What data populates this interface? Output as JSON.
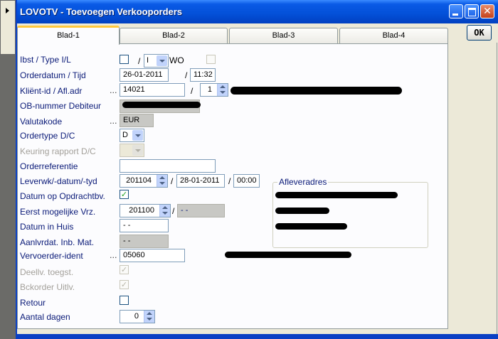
{
  "window": {
    "title": "LOVOTV - Toevoegen Verkooporders"
  },
  "tabs": [
    {
      "label": "Blad-1",
      "active": true
    },
    {
      "label": "Blad-2",
      "active": false
    },
    {
      "label": "Blad-3",
      "active": false
    },
    {
      "label": "Blad-4",
      "active": false
    }
  ],
  "ok_button": "OK",
  "form": {
    "ibst_label": "Ibst      / Type I/L",
    "ibst_type_value": "I",
    "wo_label": "WO",
    "orderdatum_label": "Orderdatum / Tijd",
    "orderdatum_value": "26-01-2011",
    "tijd_value": "11:32",
    "klient_label": "Kliënt-id / Afl.adr",
    "klient_value": "14021",
    "afladr_value": "1",
    "ob_label": "OB-nummer Debiteur",
    "valuta_label": "Valutakode",
    "valuta_value": "EUR",
    "ordertype_label": "Ordertype          D/C",
    "ordertype_value": "D",
    "keuring_label": "Keuring rapport D/C",
    "orderref_label": "Orderreferentie",
    "leverwk_label": "Leverwk/-datum/-tyd",
    "leverwk_value": "201104",
    "leverdatum_value": "28-01-2011",
    "levertijd_value": "00:00",
    "datum_opdracht_label": "Datum op Opdrachtbv.",
    "eerst_label": "Eerst mogelijke Vrz.",
    "eerst_value": "201100",
    "eerst_date_value": "- -",
    "datum_huis_label": "Datum in Huis",
    "datum_huis_value": "- -",
    "aanlvrdat_label": "Aanlvrdat. Inb. Mat.",
    "aanlvrdat_value": "- -",
    "vervoerder_label": "Vervoerder-ident",
    "vervoerder_value": "05060",
    "deellv_label": "Deellv. toegst.",
    "bckorder_label": "Bckorder Uitlv.",
    "retour_label": "Retour",
    "aantal_label": "Aantal dagen",
    "aantal_value": "0",
    "afleveradres_label": "Afleveradres",
    "slash": "/",
    "dots": "..."
  },
  "colors": {
    "title_bar": "#0350d8",
    "label_text": "#0a1a78",
    "disabled_text": "#a3a09a",
    "check_mark": "#21a121",
    "active_tab_accent": "#ffc83c"
  },
  "icons": {
    "minimize": "minimize-icon",
    "maximize": "maximize-icon",
    "close": "close-icon",
    "side_arrow": "triangle-right-icon"
  }
}
